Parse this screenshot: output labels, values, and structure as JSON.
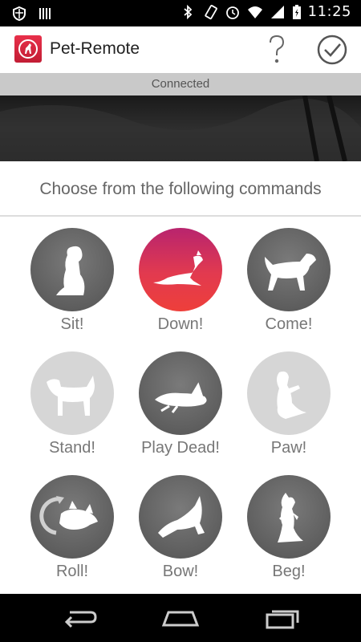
{
  "status_bar": {
    "time": "11:25",
    "icons": [
      "shield-icon",
      "barcode-icon",
      "bluetooth-icon",
      "vibrate-icon",
      "alarm-icon",
      "wifi-icon",
      "signal-icon",
      "battery-icon"
    ]
  },
  "app_bar": {
    "title": "Pet-Remote",
    "help_icon": "help-icon",
    "done_icon": "check-circle-icon"
  },
  "connection": {
    "status": "Connected"
  },
  "prompt": "Choose from the following commands",
  "commands": [
    {
      "label": "Sit!",
      "state": "enabled"
    },
    {
      "label": "Down!",
      "state": "selected"
    },
    {
      "label": "Come!",
      "state": "enabled"
    },
    {
      "label": "Stand!",
      "state": "disabled"
    },
    {
      "label": "Play Dead!",
      "state": "enabled"
    },
    {
      "label": "Paw!",
      "state": "disabled"
    },
    {
      "label": "Roll!",
      "state": "enabled"
    },
    {
      "label": "Bow!",
      "state": "enabled"
    },
    {
      "label": "Beg!",
      "state": "enabled"
    }
  ],
  "nav_bar": {
    "icons": [
      "back-icon",
      "home-icon",
      "recent-apps-icon"
    ]
  },
  "colors": {
    "accent": "#e23a4f",
    "accent_top": "#b8246e",
    "disabled": "#d6d6d6",
    "enabled": "#6a6a6a"
  }
}
